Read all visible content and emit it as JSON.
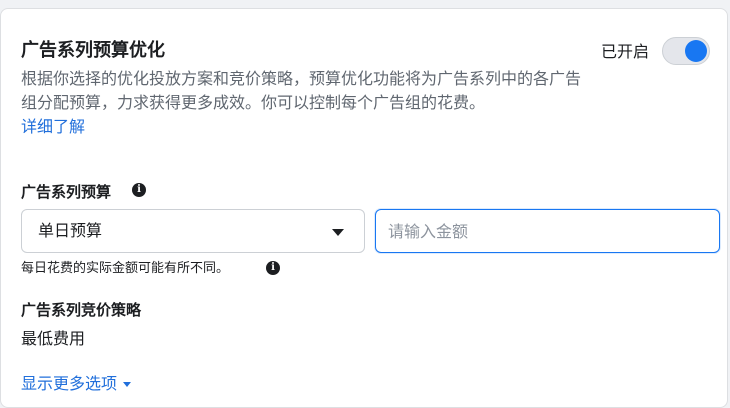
{
  "section": {
    "title": "广告系列预算优化",
    "description": "根据你选择的优化投放方案和竞价策略，预算优化功能将为广告系列中的各广告组分配预算，力求获得更多成效。你可以控制每个广告组的花费。",
    "learn_more": "详细了解",
    "toggle_label": "已开启",
    "toggle_on": true
  },
  "budget": {
    "label": "广告系列预算",
    "info_icon": "info-icon",
    "type_selected": "单日预算",
    "amount_placeholder": "请输入金额",
    "hint": "每日花费的实际金额可能有所不同。"
  },
  "bid_strategy": {
    "label": "广告系列竞价策略",
    "value": "最低费用"
  },
  "more_options": {
    "label": "显示更多选项"
  },
  "colors": {
    "accent": "#1877f2",
    "link": "#216fdb",
    "text": "#1c1e21",
    "secondary_text": "#606770"
  }
}
